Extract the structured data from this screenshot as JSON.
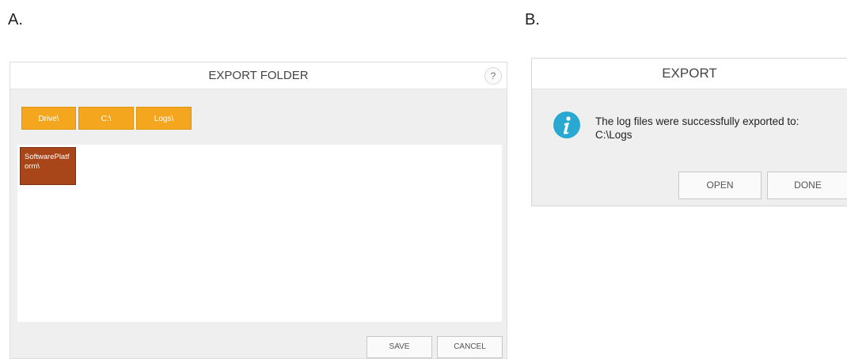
{
  "labels": {
    "a": "A.",
    "b": "B."
  },
  "export_folder": {
    "title": "EXPORT FOLDER",
    "help_label": "?",
    "breadcrumbs": [
      "Drive\\",
      "C:\\",
      "Logs\\"
    ],
    "folders": [
      "SoftwarePlatform\\"
    ],
    "save_label": "SAVE",
    "cancel_label": "CANCEL"
  },
  "export_done": {
    "title": "EXPORT",
    "message_line1": "The log files were successfully exported to:",
    "message_line2": "C:\\Logs",
    "open_label": "OPEN",
    "done_label": "DONE",
    "icon": "info-icon"
  },
  "colors": {
    "breadcrumb": "#f4a71e",
    "folder": "#a8461a",
    "info_icon": "#29a9d1"
  }
}
